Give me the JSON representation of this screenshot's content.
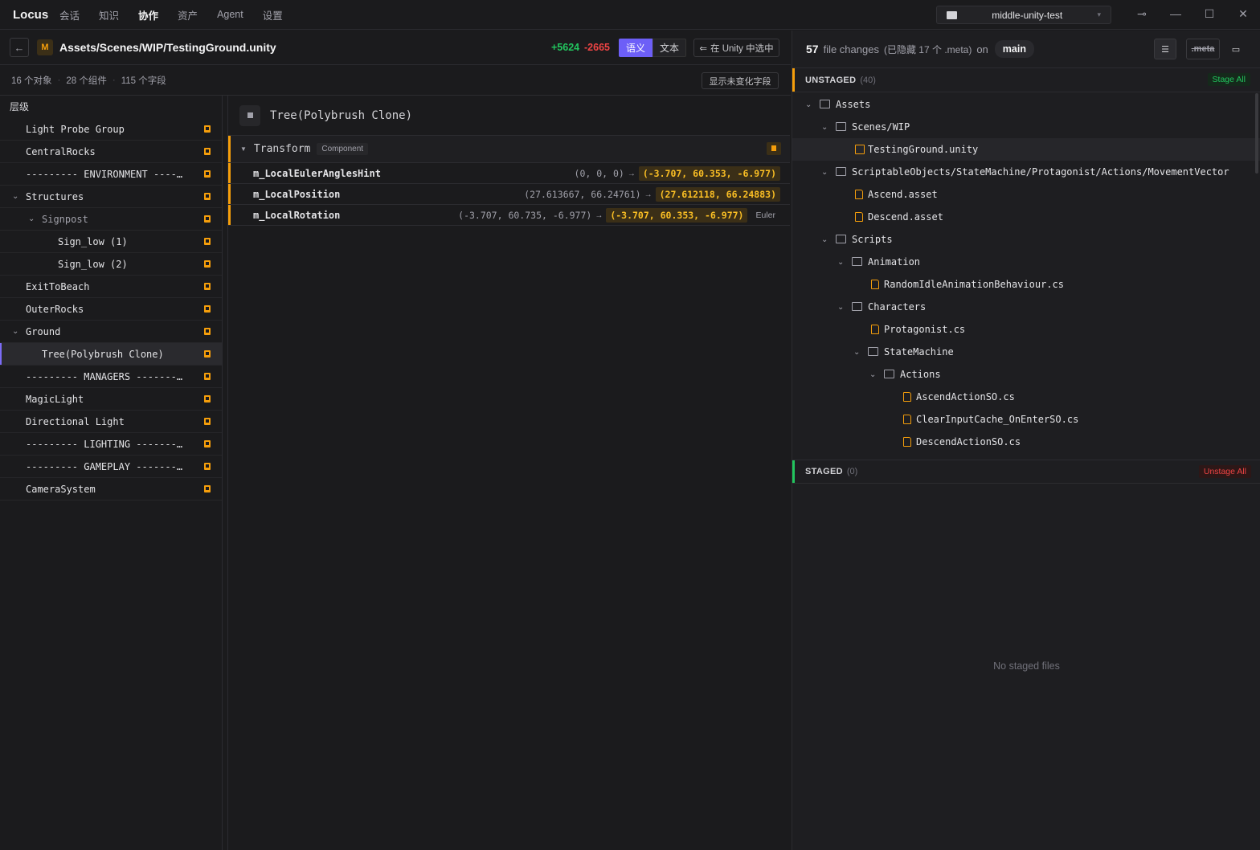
{
  "app": {
    "logo": "Locus",
    "nav": [
      "会话",
      "知识",
      "协作",
      "资产",
      "Agent",
      "设置"
    ],
    "active_nav": "协作",
    "project": "middle-unity-test"
  },
  "file_header": {
    "path": "Assets/Scenes/WIP/TestingGround.unity",
    "badge": "M",
    "additions": "+5624",
    "deletions": "-2665",
    "mode_semantic": "语义",
    "mode_text": "文本",
    "select_in_unity": "在 Unity 中选中"
  },
  "stats": {
    "objects": "16 个对象",
    "components": "28 个组件",
    "fields": "115 个字段",
    "sep": "·",
    "show_unchanged": "显示未变化字段"
  },
  "hierarchy": {
    "title": "层级",
    "items": [
      {
        "label": "Light Probe Group",
        "depth": 0
      },
      {
        "label": "CentralRocks",
        "depth": 0
      },
      {
        "label": "--------- ENVIRONMENT --------------",
        "depth": 0
      },
      {
        "label": "Structures",
        "depth": 0,
        "expanded": true
      },
      {
        "label": "Signpost",
        "depth": 1,
        "expanded": true
      },
      {
        "label": "Sign_low (1)",
        "depth": 2
      },
      {
        "label": "Sign_low (2)",
        "depth": 2
      },
      {
        "label": "ExitToBeach",
        "depth": 0
      },
      {
        "label": "OuterRocks",
        "depth": 0
      },
      {
        "label": "Ground",
        "depth": 0,
        "expanded": true
      },
      {
        "label": "Tree(Polybrush Clone)",
        "depth": 1,
        "selected": true
      },
      {
        "label": "--------- MANAGERS ----------------",
        "depth": 0
      },
      {
        "label": "MagicLight",
        "depth": 0
      },
      {
        "label": "Directional Light",
        "depth": 0
      },
      {
        "label": "--------- LIGHTING ----------------",
        "depth": 0
      },
      {
        "label": "--------- GAMEPLAY ----------------",
        "depth": 0
      },
      {
        "label": "CameraSystem",
        "depth": 0
      }
    ]
  },
  "detail": {
    "object_name": "Tree(Polybrush Clone)",
    "component": {
      "name": "Transform",
      "tag": "Component"
    },
    "properties": [
      {
        "name": "m_LocalEulerAnglesHint",
        "old": "(0, 0, 0)",
        "new": "(-3.707, 60.353, -6.977)",
        "extra": ""
      },
      {
        "name": "m_LocalPosition",
        "old": "(27.613667, 66.24761)",
        "new": "(27.612118, 66.24883)",
        "extra": ""
      },
      {
        "name": "m_LocalRotation",
        "old": "(-3.707, 60.735, -6.977)",
        "new": "(-3.707, 60.353, -6.977)",
        "extra": "Euler"
      }
    ]
  },
  "changes": {
    "count": "57",
    "label": "file changes",
    "hidden_meta": "(已隐藏 17 个 .meta)",
    "on": "on",
    "branch": "main",
    "meta_toggle": ".meta"
  },
  "unstaged": {
    "title": "UNSTAGED",
    "count": "(40)",
    "stage_all": "Stage All",
    "tree": [
      {
        "label": "Assets",
        "depth": 0,
        "type": "folder"
      },
      {
        "label": "Scenes/WIP",
        "depth": 1,
        "type": "folder"
      },
      {
        "label": "TestingGround.unity",
        "depth": 2,
        "type": "scene",
        "selected": true
      },
      {
        "label": "ScriptableObjects/StateMachine/Protagonist/Actions/MovementVector",
        "depth": 1,
        "type": "folder"
      },
      {
        "label": "Ascend.asset",
        "depth": 2,
        "type": "file"
      },
      {
        "label": "Descend.asset",
        "depth": 2,
        "type": "file"
      },
      {
        "label": "Scripts",
        "depth": 1,
        "type": "folder"
      },
      {
        "label": "Animation",
        "depth": 2,
        "type": "folder"
      },
      {
        "label": "RandomIdleAnimationBehaviour.cs",
        "depth": 3,
        "type": "file"
      },
      {
        "label": "Characters",
        "depth": 2,
        "type": "folder"
      },
      {
        "label": "Protagonist.cs",
        "depth": 3,
        "type": "file"
      },
      {
        "label": "StateMachine",
        "depth": 3,
        "type": "folder"
      },
      {
        "label": "Actions",
        "depth": 4,
        "type": "folder"
      },
      {
        "label": "AscendActionSO.cs",
        "depth": 5,
        "type": "file"
      },
      {
        "label": "ClearInputCache_OnEnterSO.cs",
        "depth": 5,
        "type": "file"
      },
      {
        "label": "DescendActionSO.cs",
        "depth": 5,
        "type": "file"
      }
    ]
  },
  "staged": {
    "title": "STAGED",
    "count": "(0)",
    "unstage_all": "Unstage All",
    "empty": "No staged files"
  },
  "colors": {
    "accent": "#6d5ff7",
    "modified": "#f59e0b",
    "added": "#22c55e",
    "deleted": "#ef4444"
  }
}
